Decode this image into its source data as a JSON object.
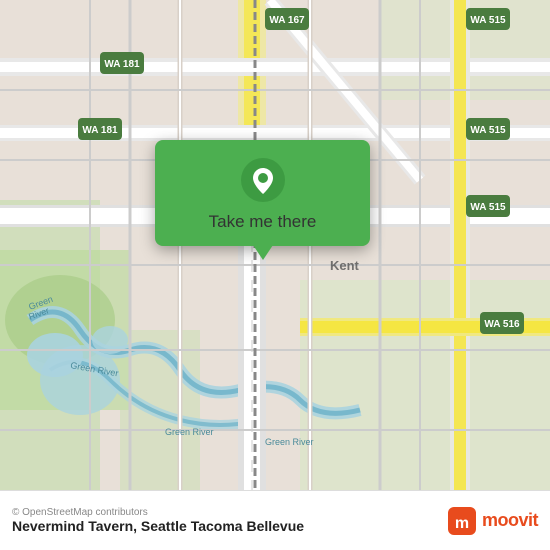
{
  "map": {
    "attribution": "© OpenStreetMap contributors",
    "location_name": "Nevermind Tavern, Seattle Tacoma Bellevue"
  },
  "popup": {
    "label": "Take me there"
  },
  "moovit": {
    "text": "moovit"
  },
  "colors": {
    "green": "#4CAF50",
    "road_yellow": "#f5e642",
    "road_white": "#ffffff",
    "water": "#aad3df",
    "park": "#c8e6c9",
    "map_bg": "#e8e0d8"
  },
  "road_labels": [
    "WA 167",
    "WA 515",
    "WA 181",
    "WA 515",
    "WA 515",
    "WA 516",
    "Green River",
    "Kent"
  ]
}
